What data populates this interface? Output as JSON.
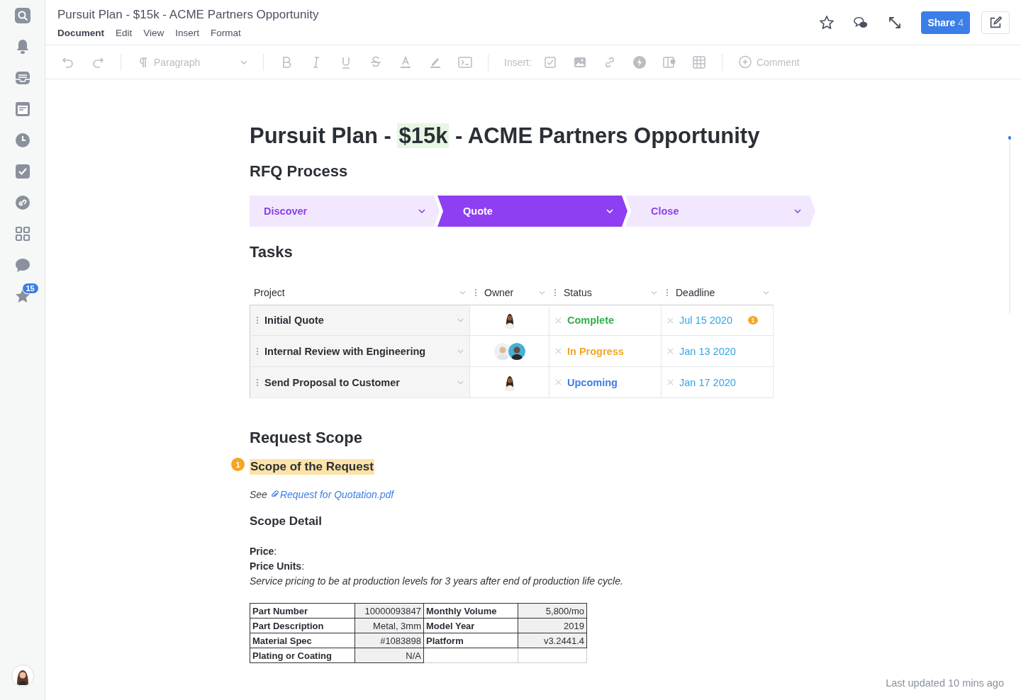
{
  "sidebar": {
    "badge": "15"
  },
  "header": {
    "title": "Pursuit Plan - $15k - ACME Partners Opportunity",
    "menu": [
      {
        "label": "Document",
        "selected": true
      },
      {
        "label": "Edit",
        "selected": false
      },
      {
        "label": "View",
        "selected": false
      },
      {
        "label": "Insert",
        "selected": false
      },
      {
        "label": "Format",
        "selected": false
      }
    ],
    "share": {
      "label": "Share",
      "count": "4"
    }
  },
  "toolbar": {
    "paragraph": "Paragraph",
    "insert_label": "Insert:",
    "comment": "Comment"
  },
  "document": {
    "title": {
      "before": "Pursuit Plan - ",
      "highlight": "$15k",
      "after": " - ACME Partners Opportunity"
    },
    "rfq_heading": "RFQ Process",
    "stages": [
      {
        "label": "Discover",
        "selected": false
      },
      {
        "label": "Quote",
        "selected": true
      },
      {
        "label": "Close",
        "selected": false
      }
    ],
    "tasks_heading": "Tasks",
    "columns": [
      "Project",
      "Owner",
      "Status",
      "Deadline"
    ],
    "rows": [
      {
        "project": "Initial Quote",
        "owners": [
          {
            "kind": "woman"
          }
        ],
        "status": {
          "text": "Complete",
          "kind": "complete"
        },
        "deadline": "Jul 15 2020",
        "comment_count": "1"
      },
      {
        "project": "Internal Review with Engineering",
        "owners": [
          {
            "kind": "man"
          },
          {
            "kind": "man"
          }
        ],
        "status": {
          "text": "In Progress",
          "kind": "in_progress"
        },
        "deadline": "Jan 13 2020"
      },
      {
        "project": "Send Proposal to Customer",
        "owners": [
          {
            "kind": "woman"
          }
        ],
        "status": {
          "text": "Upcoming",
          "kind": "upcoming"
        },
        "deadline": "Jan 17 2020"
      }
    ],
    "scope_heading": "Request Scope",
    "scope_subheading": {
      "text": "Scope of the Request",
      "comment_count": "1"
    },
    "see": {
      "prefix": "See",
      "link": "Request for Quotation.pdf"
    },
    "detail_heading": "Scope Detail",
    "lines": [
      "**Price**:",
      "**Price Units**:"
    ],
    "note": "Service pricing to be at production levels for 3 years after end of production life cycle.",
    "spec_rows": [
      [
        "Part Number",
        "10000093847",
        "Monthly Volume",
        "5,800/mo"
      ],
      [
        "Part Description",
        "Metal, 3mm",
        "Model Year",
        "2019"
      ],
      [
        "Material Spec",
        "#1083898",
        "Platform",
        "v3.2441.4"
      ],
      [
        "Plating or Coating",
        "N/A",
        "",
        ""
      ]
    ]
  },
  "footer": "Last updated 10 mins ago"
}
